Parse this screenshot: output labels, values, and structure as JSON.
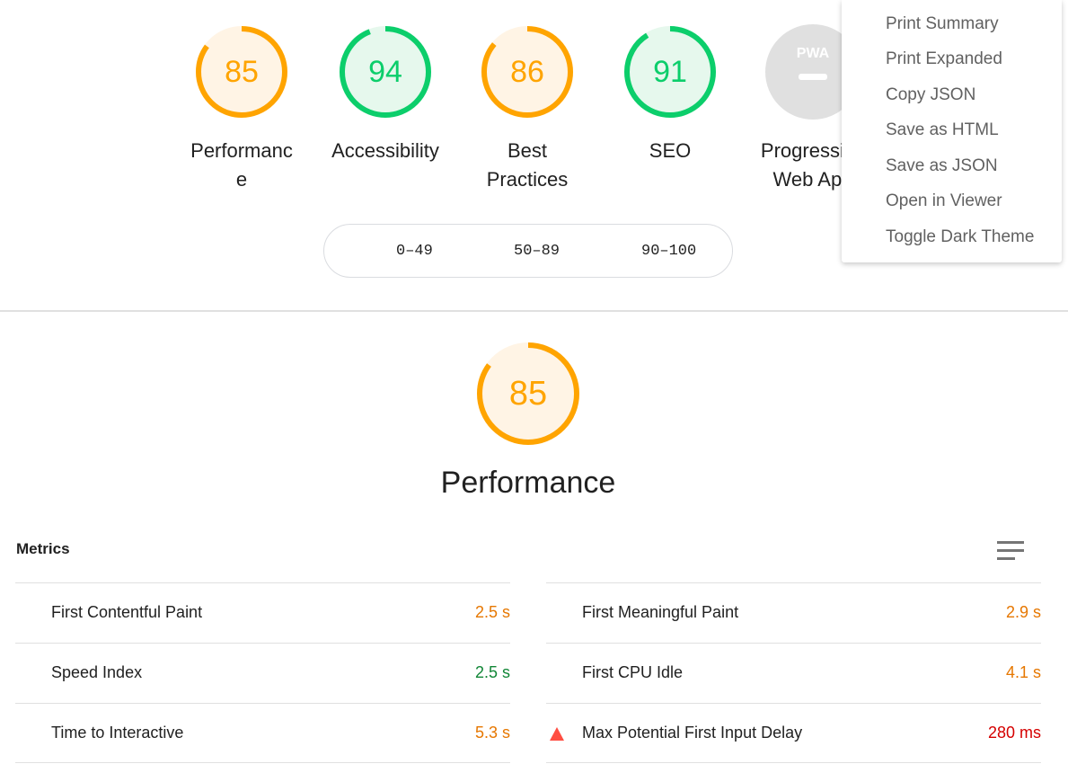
{
  "colors": {
    "average": "#ffa400",
    "average_bg": "#fff4e5",
    "pass": "#0cce6b",
    "pass_bg": "#e6f8ed",
    "fail": "#ff4e42",
    "na": "#e0e0e0",
    "metric_average": "#e67700",
    "metric_pass": "#118636",
    "metric_fail": "#d50000"
  },
  "gauges": [
    {
      "score": "85",
      "label": "Performanc e",
      "score_value": 85,
      "rating": "average"
    },
    {
      "score": "94",
      "label": "Accessibility",
      "score_value": 94,
      "rating": "pass"
    },
    {
      "score": "86",
      "label": "Best Practices",
      "score_value": 86,
      "rating": "average"
    },
    {
      "score": "91",
      "label": "SEO",
      "score_value": 91,
      "rating": "pass"
    },
    {
      "badge": "PWA",
      "label": "Progressive Web App",
      "rating": "na"
    }
  ],
  "legend": {
    "fail": "0–49",
    "average": "50–89",
    "pass": "90–100"
  },
  "menu": {
    "items": [
      "Print Summary",
      "Print Expanded",
      "Copy JSON",
      "Save as HTML",
      "Save as JSON",
      "Open in Viewer",
      "Toggle Dark Theme"
    ]
  },
  "performance": {
    "score": "85",
    "score_value": 85,
    "title": "Performance",
    "metrics_title": "Metrics",
    "toggle_icon": "lines-icon",
    "metrics": [
      {
        "name": "First Contentful Paint",
        "value": "2.5 s",
        "rating": "average"
      },
      {
        "name": "First Meaningful Paint",
        "value": "2.9 s",
        "rating": "average"
      },
      {
        "name": "Speed Index",
        "value": "2.5 s",
        "rating": "pass"
      },
      {
        "name": "First CPU Idle",
        "value": "4.1 s",
        "rating": "average"
      },
      {
        "name": "Time to Interactive",
        "value": "5.3 s",
        "rating": "average"
      },
      {
        "name": "Max Potential First Input Delay",
        "value": "280 ms",
        "rating": "fail",
        "icon": "warning-triangle-icon"
      }
    ]
  }
}
